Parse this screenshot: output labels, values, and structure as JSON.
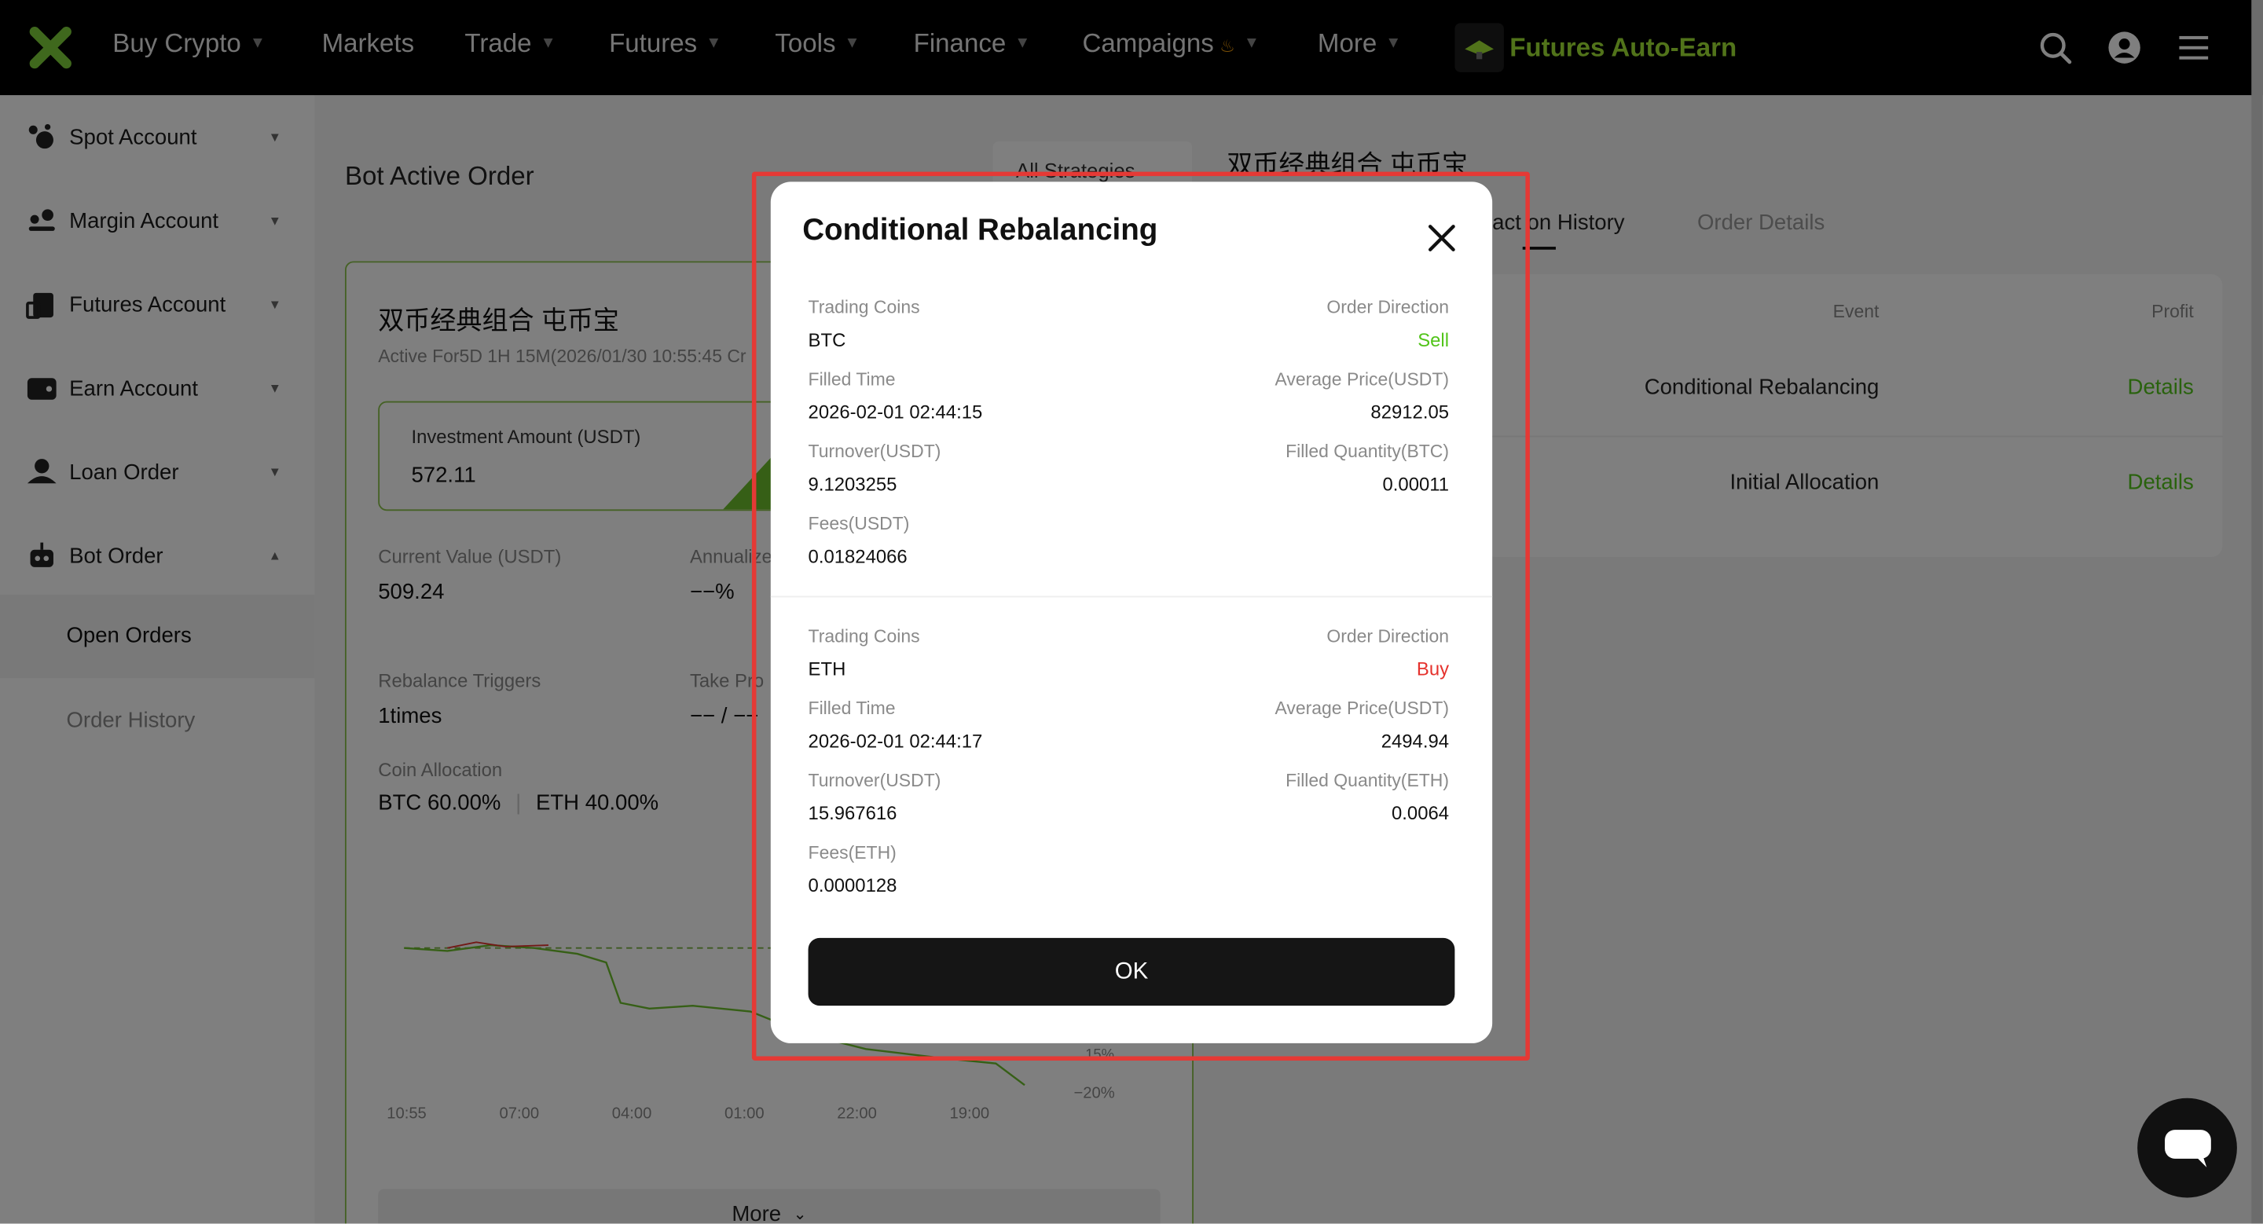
{
  "nav": {
    "items": [
      {
        "label": "Buy Crypto",
        "chevron": true
      },
      {
        "label": "Markets",
        "chevron": false
      },
      {
        "label": "Trade",
        "chevron": true
      },
      {
        "label": "Futures",
        "chevron": true
      },
      {
        "label": "Tools",
        "chevron": true
      },
      {
        "label": "Finance",
        "chevron": true
      },
      {
        "label": "Campaigns",
        "chevron": true
      },
      {
        "label": "More",
        "chevron": true
      }
    ],
    "auto_earn_label": "Futures Auto-Earn"
  },
  "sidebar": {
    "items": [
      {
        "label": "Spot Account",
        "icon": "spot-account-icon"
      },
      {
        "label": "Margin Account",
        "icon": "margin-account-icon"
      },
      {
        "label": "Futures Account",
        "icon": "futures-account-icon"
      },
      {
        "label": "Earn Account",
        "icon": "earn-account-icon"
      },
      {
        "label": "Loan Order",
        "icon": "loan-order-icon"
      },
      {
        "label": "Bot Order",
        "icon": "bot-order-icon"
      }
    ],
    "sub_items": [
      {
        "label": "Open Orders",
        "active": true
      },
      {
        "label": "Order History",
        "active": false
      }
    ]
  },
  "main": {
    "section_title": "Bot Active Order",
    "strategy_filter": "All Strategies",
    "bot_card": {
      "name": "双币经典组合 屯币宝",
      "active_for": "Active For5D 1H 15M(2026/01/30 10:55:45 Cr",
      "investment_label": "Investment Amount (USDT)",
      "investment_value": "572.11",
      "current_value_label": "Current Value (USDT)",
      "current_value": "509.24",
      "annualized_label": "Annualize",
      "annualized_value": "−−%",
      "rebalance_label": "Rebalance Triggers",
      "rebalance_value": "1times",
      "take_profit_label": "Take Pro",
      "take_profit_value": "−− / −−",
      "coin_alloc_label": "Coin Allocation",
      "coin_alloc": [
        "BTC 60.00%",
        "ETH 40.00%"
      ],
      "chart_x_labels": [
        "10:55",
        "07:00",
        "04:00",
        "01:00",
        "22:00",
        "19:00"
      ],
      "chart_y_labels": [
        "15%",
        "−20%"
      ],
      "more_label": "More"
    },
    "right_panel": {
      "title": "双币经典组合 屯币宝",
      "tabs": [
        "Transaction History",
        "Order Details"
      ],
      "tab_visible": "act on History",
      "columns": [
        "Event",
        "Profit"
      ],
      "rows": [
        {
          "event": "Conditional Rebalancing",
          "action": "Details"
        },
        {
          "event": "Initial Allocation",
          "action": "Details"
        }
      ]
    }
  },
  "modal": {
    "title": "Conditional Rebalancing",
    "ok_label": "OK",
    "trades": [
      {
        "trading_coins_label": "Trading Coins",
        "trading_coins": "BTC",
        "direction_label": "Order Direction",
        "direction": "Sell",
        "direction_color": "#52c41a",
        "filled_time_label": "Filled Time",
        "filled_time": "2026-02-01 02:44:15",
        "avg_price_label": "Average Price(USDT)",
        "avg_price": "82912.05",
        "turnover_label": "Turnover(USDT)",
        "turnover": "9.1203255",
        "filled_qty_label": "Filled Quantity(BTC)",
        "filled_qty": "0.00011",
        "fees_label": "Fees(USDT)",
        "fees": "0.01824066"
      },
      {
        "trading_coins_label": "Trading Coins",
        "trading_coins": "ETH",
        "direction_label": "Order Direction",
        "direction": "Buy",
        "direction_color": "#e5322d",
        "filled_time_label": "Filled Time",
        "filled_time": "2026-02-01 02:44:17",
        "avg_price_label": "Average Price(USDT)",
        "avg_price": "2494.94",
        "turnover_label": "Turnover(USDT)",
        "turnover": "15.967616",
        "filled_qty_label": "Filled Quantity(ETH)",
        "filled_qty": "0.0064",
        "fees_label": "Fees(ETH)",
        "fees": "0.0000128"
      }
    ]
  },
  "colors": {
    "accent_green": "#52c41a",
    "sell": "#52c41a",
    "buy": "#e5322d",
    "brand": "#a3e635"
  }
}
